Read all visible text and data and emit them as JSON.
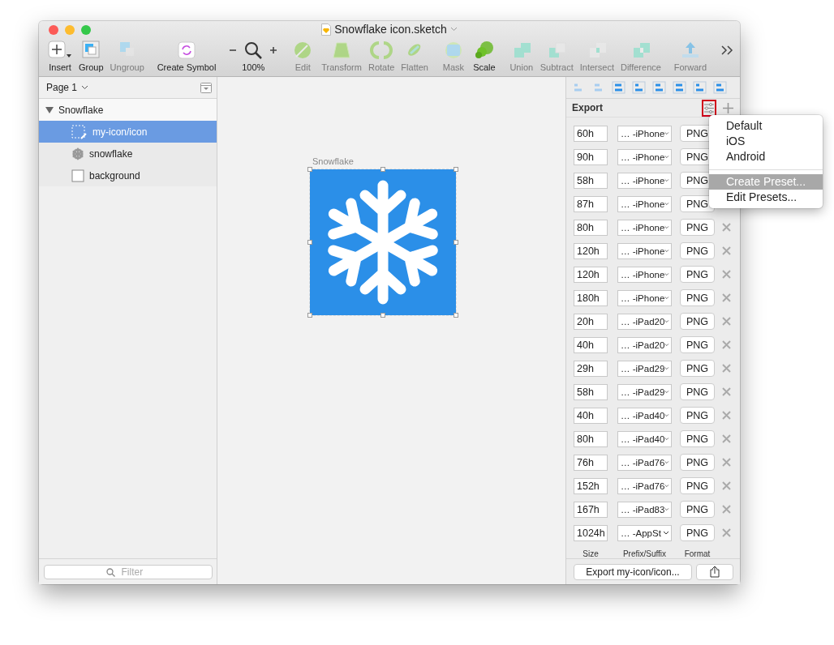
{
  "window": {
    "title": "Snowflake icon.sketch"
  },
  "toolbar": [
    {
      "kind": "insert",
      "label": "Insert",
      "disabled": false
    },
    {
      "kind": "group",
      "label": "Group",
      "disabled": false
    },
    {
      "kind": "ungroup",
      "label": "Ungroup",
      "disabled": true
    },
    {
      "kind": "symbol",
      "label": "Create Symbol",
      "disabled": false
    },
    {
      "kind": "zoom",
      "label": "100%",
      "disabled": false
    },
    {
      "kind": "edit",
      "label": "Edit",
      "disabled": true
    },
    {
      "kind": "transform",
      "label": "Transform",
      "disabled": true
    },
    {
      "kind": "rotate",
      "label": "Rotate",
      "disabled": true
    },
    {
      "kind": "flatten",
      "label": "Flatten",
      "disabled": true
    },
    {
      "kind": "mask",
      "label": "Mask",
      "disabled": true
    },
    {
      "kind": "scale",
      "label": "Scale",
      "disabled": false
    },
    {
      "kind": "union",
      "label": "Union",
      "disabled": true
    },
    {
      "kind": "subtract",
      "label": "Subtract",
      "disabled": true
    },
    {
      "kind": "intersect",
      "label": "Intersect",
      "disabled": true
    },
    {
      "kind": "difference",
      "label": "Difference",
      "disabled": true
    },
    {
      "kind": "forward",
      "label": "Forward",
      "disabled": true
    },
    {
      "kind": "more"
    }
  ],
  "sidebar": {
    "page": "Page 1",
    "layers": [
      {
        "kind": "artboard",
        "name": "Snowflake",
        "expanded": true,
        "selected": false,
        "children": [
          {
            "kind": "slice",
            "name": "my-icon/icon",
            "selected": true
          },
          {
            "kind": "snowflake",
            "name": "snowflake",
            "selected": false
          },
          {
            "kind": "rectangle",
            "name": "background",
            "selected": false
          }
        ]
      }
    ],
    "filter": {
      "placeholder": "Filter"
    }
  },
  "canvas": {
    "artboard": {
      "name": "Snowflake",
      "color": "#2b8fe8",
      "selected": true
    }
  },
  "export": {
    "title": "Export",
    "rows": [
      {
        "size": "60h",
        "prefix": "… -iPhone",
        "format": "PNG",
        "delete_visible": false
      },
      {
        "size": "90h",
        "prefix": "… -iPhone",
        "format": "PNG",
        "delete_visible": false
      },
      {
        "size": "58h",
        "prefix": "… -iPhone",
        "format": "PNG",
        "delete_visible": false
      },
      {
        "size": "87h",
        "prefix": "… -iPhone",
        "format": "PNG",
        "delete_visible": false
      },
      {
        "size": "80h",
        "prefix": "… -iPhone",
        "format": "PNG",
        "delete_visible": true
      },
      {
        "size": "120h",
        "prefix": "… -iPhone",
        "format": "PNG",
        "delete_visible": true
      },
      {
        "size": "120h",
        "prefix": "… -iPhone",
        "format": "PNG",
        "delete_visible": true
      },
      {
        "size": "180h",
        "prefix": "… -iPhone",
        "format": "PNG",
        "delete_visible": true
      },
      {
        "size": "20h",
        "prefix": "… -iPad20",
        "format": "PNG",
        "delete_visible": true
      },
      {
        "size": "40h",
        "prefix": "… -iPad20",
        "format": "PNG",
        "delete_visible": true
      },
      {
        "size": "29h",
        "prefix": "… -iPad29",
        "format": "PNG",
        "delete_visible": true
      },
      {
        "size": "58h",
        "prefix": "… -iPad29",
        "format": "PNG",
        "delete_visible": true
      },
      {
        "size": "40h",
        "prefix": "… -iPad40",
        "format": "PNG",
        "delete_visible": true
      },
      {
        "size": "80h",
        "prefix": "… -iPad40",
        "format": "PNG",
        "delete_visible": true
      },
      {
        "size": "76h",
        "prefix": "… -iPad76",
        "format": "PNG",
        "delete_visible": true
      },
      {
        "size": "152h",
        "prefix": "… -iPad76",
        "format": "PNG",
        "delete_visible": true
      },
      {
        "size": "167h",
        "prefix": "… -iPad83",
        "format": "PNG",
        "delete_visible": true
      },
      {
        "size": "1024h",
        "prefix": "… -AppSt",
        "format": "PNG",
        "delete_visible": true
      }
    ],
    "columns": [
      "Size",
      "Prefix/Suffix",
      "Format"
    ],
    "export_button": "Export my-icon/icon..."
  },
  "presets_menu": {
    "open": true,
    "items": [
      {
        "kind": "item",
        "label": "Default",
        "highlighted": false
      },
      {
        "kind": "item",
        "label": "iOS",
        "highlighted": false
      },
      {
        "kind": "item",
        "label": "Android",
        "highlighted": false
      },
      {
        "kind": "separator"
      },
      {
        "kind": "item",
        "label": "Create Preset...",
        "highlighted": true
      },
      {
        "kind": "item",
        "label": "Edit Presets...",
        "highlighted": false
      }
    ]
  }
}
